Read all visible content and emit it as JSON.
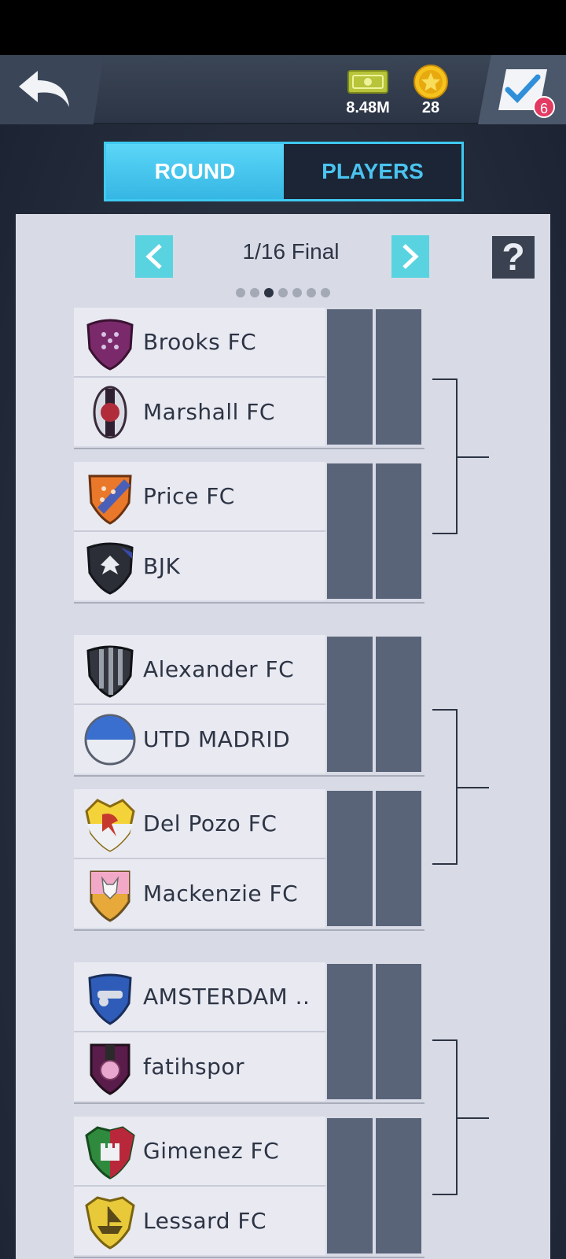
{
  "header": {
    "cash_value": "8.48M",
    "coins_value": "28",
    "tasks_badge": "6"
  },
  "tabs": [
    {
      "label": "ROUND",
      "active": true
    },
    {
      "label": "PLAYERS",
      "active": false
    }
  ],
  "round": {
    "title": "1/16 Final",
    "help_label": "?",
    "page_count": 7,
    "active_page": 3
  },
  "matches": [
    {
      "home": {
        "name": "Brooks  FC",
        "crest": "purple-stars-shield-icon"
      },
      "away": {
        "name": "Marshall  FC",
        "crest": "red-black-oval-crest-icon"
      }
    },
    {
      "home": {
        "name": "Price  FC",
        "crest": "orange-stars-shield-icon"
      },
      "away": {
        "name": "BJK",
        "crest": "black-eagle-shield-icon"
      }
    },
    {
      "home": {
        "name": "Alexander  FC",
        "crest": "black-stripes-shield-icon"
      },
      "away": {
        "name": "UTD MADRID",
        "crest": "blue-white-round-crest-icon"
      }
    },
    {
      "home": {
        "name": "Del Pozo FC",
        "crest": "yellow-red-bird-shield-icon"
      },
      "away": {
        "name": "Mackenzie  FC",
        "crest": "pink-yellow-wolf-shield-icon"
      }
    },
    {
      "home": {
        "name": "AMSTERDAM ..",
        "crest": "blue-cannon-shield-icon"
      },
      "away": {
        "name": "fatihspor",
        "crest": "purple-ball-shield-icon"
      }
    },
    {
      "home": {
        "name": "Gimenez FC",
        "crest": "green-red-castle-shield-icon"
      },
      "away": {
        "name": "Lessard FC",
        "crest": "gold-ship-shield-icon"
      }
    }
  ],
  "colors": {
    "accent_cyan": "#3fc9f0",
    "score_box": "#5a6479",
    "panel_bg": "#d8dbe6",
    "badge_red": "#e23a63"
  }
}
